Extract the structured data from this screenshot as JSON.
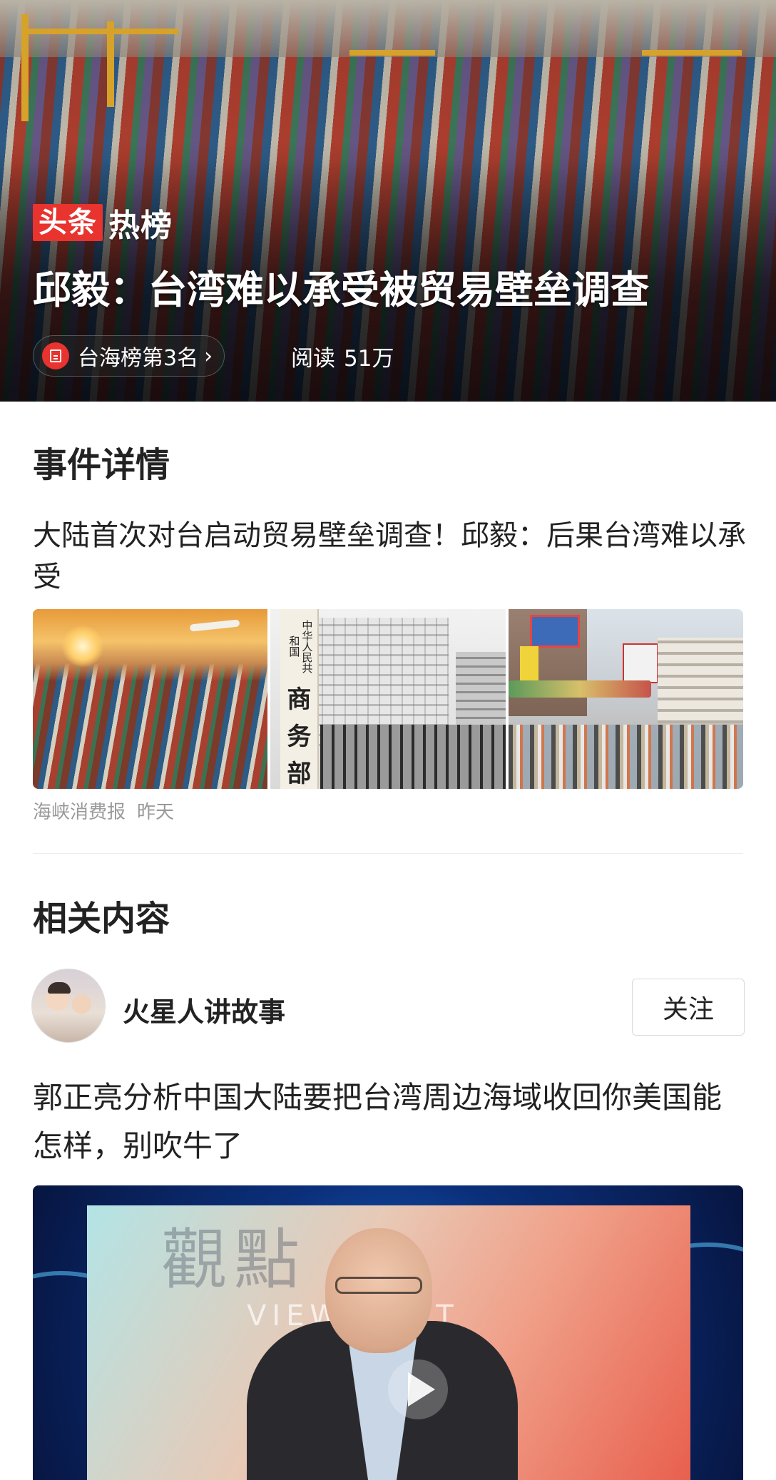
{
  "hero": {
    "brand_box": "头条",
    "brand_hot": "热榜",
    "title": "邱毅：台湾难以承受被贸易壁垒调查",
    "rank_label": "台海榜第3名",
    "rank_chevron": "›",
    "reads_label": "阅读",
    "reads_value": "51万",
    "badge_color": "#e8332e"
  },
  "event": {
    "section_title": "事件详情",
    "article_title": "大陆首次对台启动贸易壁垒调查！邱毅：后果台湾难以承受",
    "images": [
      {
        "icon": "port-container-photo"
      },
      {
        "icon": "ministry-building-photo",
        "sign_small": "中华人民共和国",
        "sign_big": [
          "商",
          "务",
          "部"
        ]
      },
      {
        "icon": "street-market-photo"
      }
    ],
    "source": "海峡消费报",
    "time": "昨天"
  },
  "related": {
    "section_title": "相关内容",
    "author_name": "火星人讲故事",
    "follow_label": "关注",
    "post_title": "郭正亮分析中国大陆要把台湾周边海域收回你美国能怎样，别吹牛了",
    "video_watermark": "觀點",
    "video_watermark_sub": "VIEWPOINT"
  }
}
